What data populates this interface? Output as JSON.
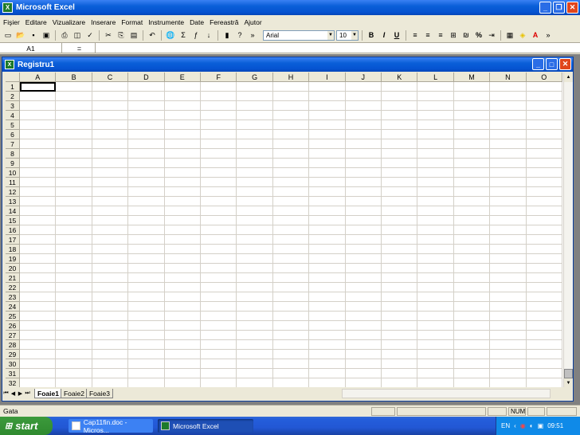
{
  "title": "Microsoft Excel",
  "menu": [
    "Fişier",
    "Editare",
    "Vizualizare",
    "Inserare",
    "Format",
    "Instrumente",
    "Date",
    "Fereastră",
    "Ajutor"
  ],
  "toolbar": {
    "font": "Arial",
    "size": "10",
    "icons": [
      "new-icon",
      "open-icon",
      "save-icon",
      "permission-icon",
      "print-icon",
      "print-preview-icon",
      "spelling-icon",
      "cut-icon",
      "copy-icon",
      "paste-icon",
      "undo-icon",
      "hyperlink-icon",
      "autosum-icon",
      "function-icon",
      "sort-ascending-icon",
      "chart-wizard-icon",
      "help-icon",
      "more-icon"
    ]
  },
  "formula": {
    "namebox": "A1",
    "eq": "="
  },
  "workbook": {
    "title": "Registru1"
  },
  "columns": [
    "A",
    "B",
    "C",
    "D",
    "E",
    "F",
    "G",
    "H",
    "I",
    "J",
    "K",
    "L",
    "M",
    "N",
    "O"
  ],
  "rows": [
    "1",
    "2",
    "3",
    "4",
    "5",
    "6",
    "7",
    "8",
    "9",
    "10",
    "11",
    "12",
    "13",
    "14",
    "15",
    "16",
    "17",
    "18",
    "19",
    "20",
    "21",
    "22",
    "23",
    "24",
    "25",
    "26",
    "27",
    "28",
    "29",
    "30",
    "31",
    "32"
  ],
  "sheets": [
    "Foaie1",
    "Foaie2",
    "Foaie3"
  ],
  "status": {
    "ready": "Gata",
    "num": "NUM"
  },
  "taskbar": {
    "start": "start",
    "tasks": [
      "Cap11fin.doc - Micros...",
      "Microsoft Excel"
    ],
    "lang": "EN",
    "clock": "09:51"
  }
}
